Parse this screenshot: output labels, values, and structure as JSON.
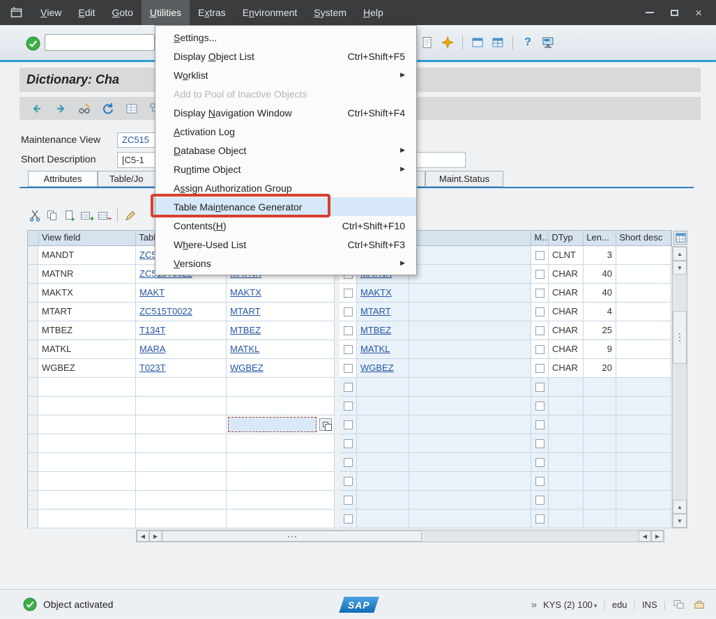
{
  "icons": {
    "close": "×",
    "submenu_arrow": "▶",
    "scroll_up": "▲",
    "scroll_down": "▼",
    "scroll_left": "◀",
    "scroll_right": "▶",
    "caret": "▾",
    "help": "?"
  },
  "menubar": {
    "items": [
      {
        "pre": "",
        "accel": "V",
        "post": "iew",
        "active": false
      },
      {
        "pre": "",
        "accel": "E",
        "post": "dit",
        "active": false
      },
      {
        "pre": "",
        "accel": "G",
        "post": "oto",
        "active": false
      },
      {
        "pre": "",
        "accel": "U",
        "post": "tilities",
        "active": true
      },
      {
        "pre": "E",
        "accel": "x",
        "post": "tras",
        "active": false
      },
      {
        "pre": "E",
        "accel": "n",
        "post": "vironment",
        "active": false
      },
      {
        "pre": "",
        "accel": "S",
        "post": "ystem",
        "active": false
      },
      {
        "pre": "",
        "accel": "H",
        "post": "elp",
        "active": false
      }
    ]
  },
  "menu": {
    "items": [
      {
        "pre": "",
        "accel": "S",
        "post": "ettings...",
        "shortcut": "",
        "submenu": false,
        "disabled": false,
        "highlighted": false
      },
      {
        "pre": "Display ",
        "accel": "O",
        "post": "bject List",
        "shortcut": "Ctrl+Shift+F5",
        "submenu": false,
        "disabled": false,
        "highlighted": false
      },
      {
        "pre": "W",
        "accel": "o",
        "post": "rklist",
        "shortcut": "",
        "submenu": true,
        "disabled": false,
        "highlighted": false
      },
      {
        "pre": "",
        "accel": "",
        "post": "Add to Pool of Inactive Objects",
        "shortcut": "",
        "submenu": false,
        "disabled": true,
        "highlighted": false
      },
      {
        "pre": "Display ",
        "accel": "N",
        "post": "avigation Window",
        "shortcut": "Ctrl+Shift+F4",
        "submenu": false,
        "disabled": false,
        "highlighted": false
      },
      {
        "pre": "",
        "accel": "A",
        "post": "ctivation Log",
        "shortcut": "",
        "submenu": false,
        "disabled": false,
        "highlighted": false
      },
      {
        "pre": "",
        "accel": "D",
        "post": "atabase Object",
        "shortcut": "",
        "submenu": true,
        "disabled": false,
        "highlighted": false
      },
      {
        "pre": "Ru",
        "accel": "n",
        "post": "time Object",
        "shortcut": "",
        "submenu": true,
        "disabled": false,
        "highlighted": false
      },
      {
        "pre": "A",
        "accel": "s",
        "post": "sign Authorization Group",
        "shortcut": "",
        "submenu": false,
        "disabled": false,
        "highlighted": false
      },
      {
        "pre": "Table Mai",
        "accel": "n",
        "post": "tenance Generator",
        "shortcut": "",
        "submenu": false,
        "disabled": false,
        "highlighted": true
      },
      {
        "pre": "Contents(",
        "accel": "H",
        "post": ")",
        "shortcut": "Ctrl+Shift+F10",
        "submenu": false,
        "disabled": false,
        "highlighted": false
      },
      {
        "pre": "W",
        "accel": "h",
        "post": "ere-Used List",
        "shortcut": "Ctrl+Shift+F3",
        "submenu": false,
        "disabled": false,
        "highlighted": false
      },
      {
        "pre": "",
        "accel": "V",
        "post": "ersions",
        "shortcut": "",
        "submenu": true,
        "disabled": false,
        "highlighted": false
      }
    ]
  },
  "annotation": {
    "target": "Table Maintenance Generator",
    "color": "#d6402f"
  },
  "toolbar": {
    "command_value": ""
  },
  "title": "Dictionary: Cha",
  "form": {
    "maintenance_view_label": "Maintenance View",
    "maintenance_view_value": "ZC515",
    "short_description_label": "Short Description",
    "short_description_value": "[C5-1"
  },
  "tabstrip": {
    "tabs": [
      {
        "label": "Attributes",
        "selected": true
      },
      {
        "label": "Table/Jo",
        "selected": false
      },
      {
        "label": "Maint.Status",
        "selected": false
      }
    ]
  },
  "table": {
    "headers": {
      "view_field": "View field",
      "table": "Table",
      "m": "M...",
      "dtyp": "DTyp",
      "len": "Len...",
      "short_desc": "Short desc"
    },
    "focused_cell": {
      "row_index": 9,
      "column": "field"
    },
    "rows": [
      {
        "view_field": "MANDT",
        "table": "ZC515T0022",
        "field": "",
        "key_checked": false,
        "field2": "",
        "m_checked": false,
        "dtyp": "CLNT",
        "len": "3",
        "short_desc": ""
      },
      {
        "view_field": "MATNR",
        "table": "ZC515T0022",
        "field": "MATNR",
        "key_checked": true,
        "field2": "MATNR",
        "m_checked": false,
        "dtyp": "CHAR",
        "len": "40",
        "short_desc": ""
      },
      {
        "view_field": "MAKTX",
        "table": "MAKT",
        "field": "MAKTX",
        "key_checked": false,
        "field2": "MAKTX",
        "m_checked": false,
        "dtyp": "CHAR",
        "len": "40",
        "short_desc": ""
      },
      {
        "view_field": "MTART",
        "table": "ZC515T0022",
        "field": "MTART",
        "key_checked": false,
        "field2": "MTART",
        "m_checked": false,
        "dtyp": "CHAR",
        "len": "4",
        "short_desc": ""
      },
      {
        "view_field": "MTBEZ",
        "table": "T134T",
        "field": "MTBEZ",
        "key_checked": false,
        "field2": "MTBEZ",
        "m_checked": false,
        "dtyp": "CHAR",
        "len": "25",
        "short_desc": ""
      },
      {
        "view_field": "MATKL",
        "table": "MARA",
        "field": "MATKL",
        "key_checked": false,
        "field2": "MATKL",
        "m_checked": false,
        "dtyp": "CHAR",
        "len": "9",
        "short_desc": ""
      },
      {
        "view_field": "WGBEZ",
        "table": "T023T",
        "field": "WGBEZ",
        "key_checked": false,
        "field2": "WGBEZ",
        "m_checked": false,
        "dtyp": "CHAR",
        "len": "20",
        "short_desc": ""
      },
      {
        "view_field": "",
        "table": "",
        "field": "",
        "key_checked": false,
        "field2": "",
        "m_checked": false,
        "dtyp": "",
        "len": "",
        "short_desc": ""
      },
      {
        "view_field": "",
        "table": "",
        "field": "",
        "key_checked": false,
        "field2": "",
        "m_checked": false,
        "dtyp": "",
        "len": "",
        "short_desc": ""
      },
      {
        "view_field": "",
        "table": "",
        "field": "",
        "key_checked": false,
        "field2": "",
        "m_checked": false,
        "dtyp": "",
        "len": "",
        "short_desc": ""
      },
      {
        "view_field": "",
        "table": "",
        "field": "",
        "key_checked": false,
        "field2": "",
        "m_checked": false,
        "dtyp": "",
        "len": "",
        "short_desc": ""
      },
      {
        "view_field": "",
        "table": "",
        "field": "",
        "key_checked": false,
        "field2": "",
        "m_checked": false,
        "dtyp": "",
        "len": "",
        "short_desc": ""
      },
      {
        "view_field": "",
        "table": "",
        "field": "",
        "key_checked": false,
        "field2": "",
        "m_checked": false,
        "dtyp": "",
        "len": "",
        "short_desc": ""
      },
      {
        "view_field": "",
        "table": "",
        "field": "",
        "key_checked": false,
        "field2": "",
        "m_checked": false,
        "dtyp": "",
        "len": "",
        "short_desc": ""
      },
      {
        "view_field": "",
        "table": "",
        "field": "",
        "key_checked": false,
        "field2": "",
        "m_checked": false,
        "dtyp": "",
        "len": "",
        "short_desc": ""
      }
    ]
  },
  "statusbar": {
    "message": "Object activated",
    "logo": "SAP",
    "chevrons": "»",
    "system": "KYS (2) 100",
    "lang": "edu",
    "mode": "INS"
  }
}
